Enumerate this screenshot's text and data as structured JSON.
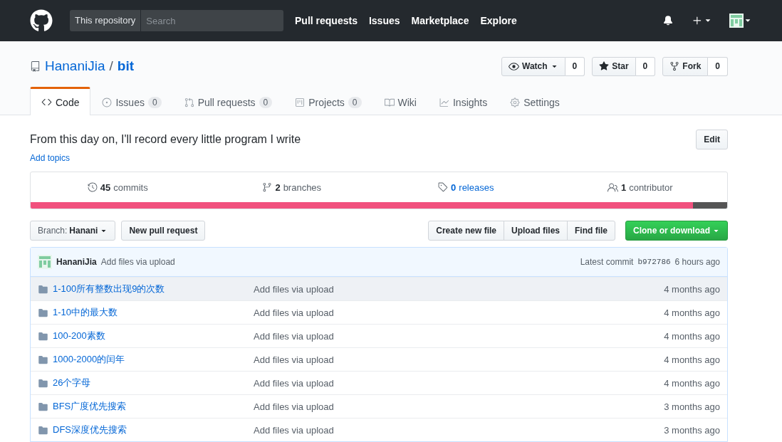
{
  "header": {
    "scope": "This repository",
    "search": {
      "placeholder": "Search"
    },
    "nav": [
      "Pull requests",
      "Issues",
      "Marketplace",
      "Explore"
    ]
  },
  "repo": {
    "owner": "HananiJia",
    "separator": "/",
    "name": "bit",
    "actions": [
      {
        "kind": "watch",
        "label": "Watch",
        "count": "0"
      },
      {
        "kind": "star",
        "label": "Star",
        "count": "0"
      },
      {
        "kind": "fork",
        "label": "Fork",
        "count": "0"
      }
    ]
  },
  "tabs": [
    {
      "kind": "code",
      "label": "Code",
      "selected": true
    },
    {
      "kind": "issues",
      "label": "Issues",
      "counter": "0",
      "selected": false
    },
    {
      "kind": "pulls",
      "label": "Pull requests",
      "counter": "0",
      "selected": false
    },
    {
      "kind": "projects",
      "label": "Projects",
      "counter": "0",
      "selected": false
    },
    {
      "kind": "wiki",
      "label": "Wiki",
      "selected": false
    },
    {
      "kind": "insights",
      "label": "Insights",
      "selected": false
    },
    {
      "kind": "settings",
      "label": "Settings",
      "selected": false
    }
  ],
  "description": "From this day on, I'll record every little program I write",
  "edit_button": "Edit",
  "add_topics": "Add topics",
  "summary": [
    {
      "kind": "commits",
      "count": "45",
      "label": "commits"
    },
    {
      "kind": "branches",
      "count": "2",
      "label": "branches"
    },
    {
      "kind": "releases",
      "count": "0",
      "label": "releases"
    },
    {
      "kind": "contributors",
      "count": "1",
      "label": "contributor"
    }
  ],
  "language_bar": [
    {
      "color": "#f1517e",
      "level": 0.951
    },
    {
      "color": "#555555",
      "level": 0.049
    }
  ],
  "branch": {
    "prefix": "Branch:",
    "name": "Hanani"
  },
  "new_pull_request": "New pull request",
  "file_buttons": [
    "Create new file",
    "Upload files",
    "Find file"
  ],
  "clone_button": "Clone or download",
  "commit": {
    "author": "HananiJia",
    "message": "Add files via upload",
    "latest": "Latest commit",
    "sha": "b972786",
    "age": "6 hours ago"
  },
  "files": [
    {
      "name": "1-100所有整数出现9的次数",
      "message": "Add files via upload",
      "age": "4 months ago",
      "highlighted": true
    },
    {
      "name": "1-10中的最大数",
      "message": "Add files via upload",
      "age": "4 months ago",
      "highlighted": false
    },
    {
      "name": "100-200素数",
      "message": "Add files via upload",
      "age": "4 months ago",
      "highlighted": false
    },
    {
      "name": "1000-2000的闰年",
      "message": "Add files via upload",
      "age": "4 months ago",
      "highlighted": false
    },
    {
      "name": "26个字母",
      "message": "Add files via upload",
      "age": "4 months ago",
      "highlighted": false
    },
    {
      "name": "BFS广度优先搜索",
      "message": "Add files via upload",
      "age": "3 months ago",
      "highlighted": false
    },
    {
      "name": "DFS深度优先搜索",
      "message": "Add files via upload",
      "age": "3 months ago",
      "highlighted": false
    }
  ]
}
